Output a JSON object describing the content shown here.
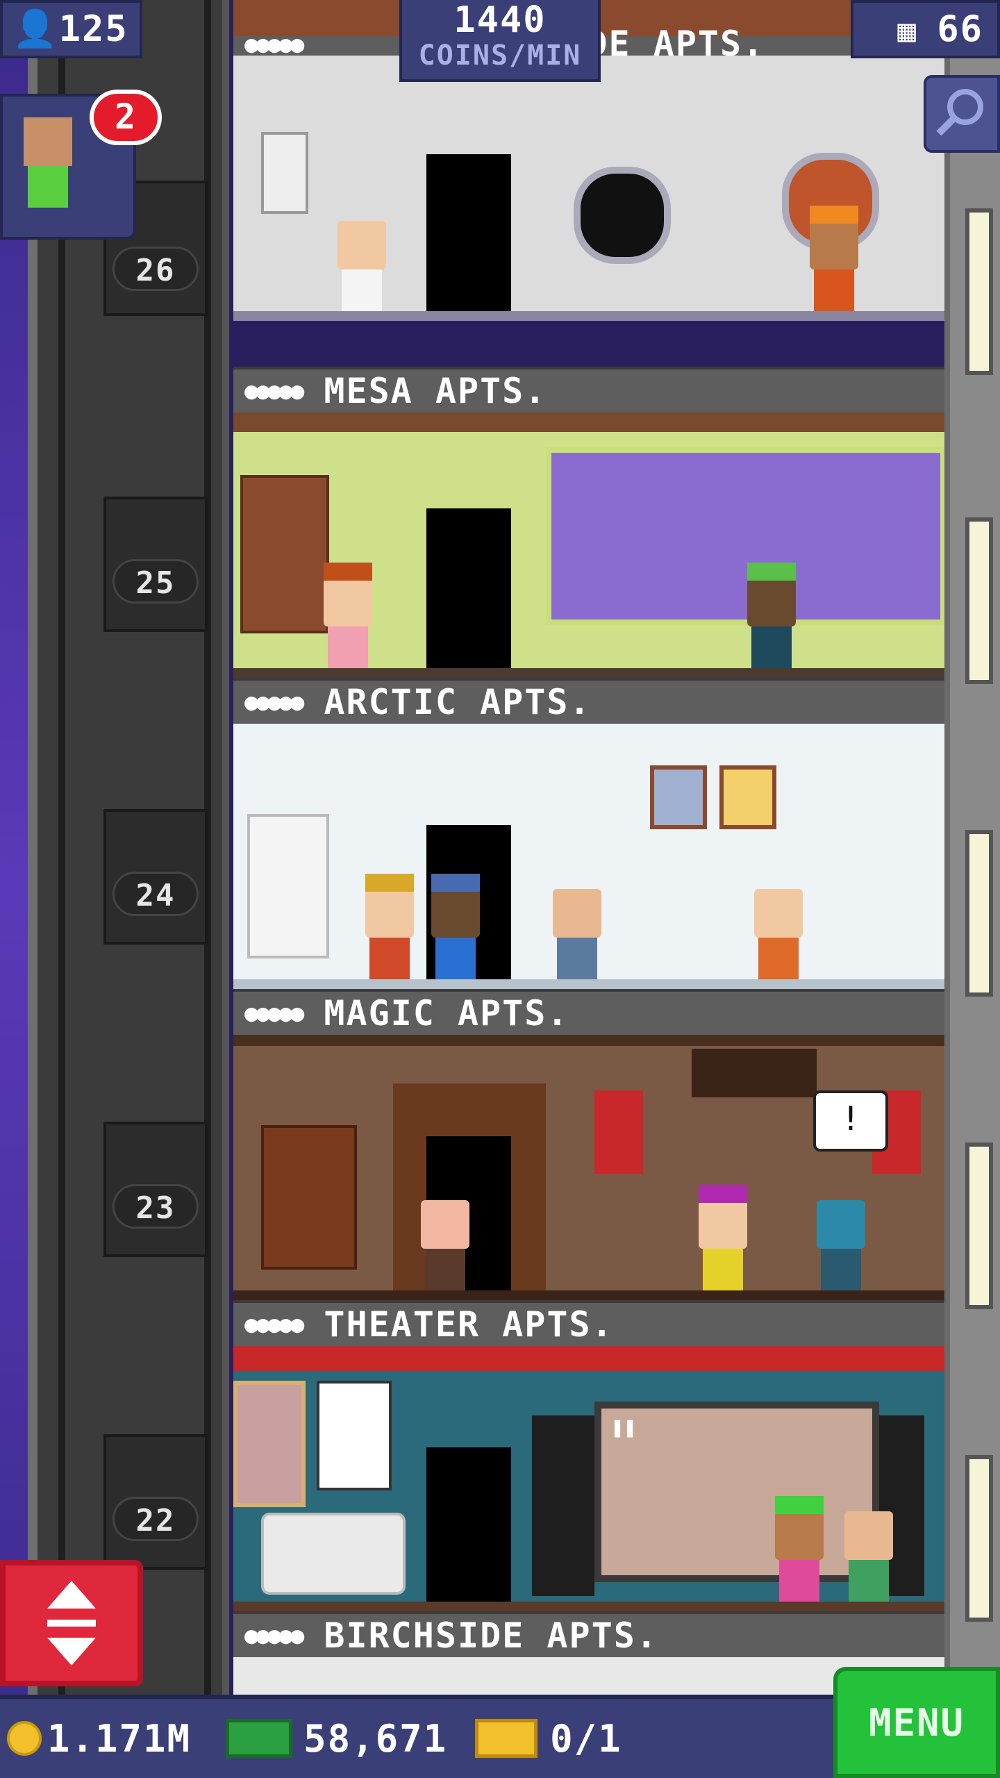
{
  "top_bar": {
    "population": "125",
    "coins_rate_value": "1440",
    "coins_rate_unit": "COINS/MIN",
    "floors_count": "66",
    "top_floor_label": "ARCADE APTS."
  },
  "visitor": {
    "badge_count": "2"
  },
  "floor_numbers": [
    "26",
    "25",
    "24",
    "23",
    "22"
  ],
  "floors": [
    {
      "name": "MESA APTS.",
      "people_icons": "●●●●●"
    },
    {
      "name": "ARCTIC APTS.",
      "people_icons": "●●●●●"
    },
    {
      "name": "MAGIC APTS.",
      "people_icons": "●●●●●"
    },
    {
      "name": "THEATER APTS.",
      "people_icons": "●●●●●"
    },
    {
      "name": "BIRCHSIDE APTS.",
      "people_icons": "●●●●●"
    }
  ],
  "bottom_bar": {
    "coins": "1.171M",
    "bux": "58,671",
    "tickets": "0/1",
    "menu_label": "MENU"
  },
  "colors": {
    "ui_panel": "#3a3f78",
    "menu_green": "#23c23a",
    "elevator_red": "#e0283c",
    "badge_red": "#e31b2b"
  },
  "icons": {
    "population": "person-icon",
    "floors": "building-icon",
    "zoom": "magnifier-icon",
    "coin": "coin-icon",
    "bux": "cash-icon",
    "ticket": "ticket-icon",
    "elevator": "up-down-arrows-icon"
  }
}
